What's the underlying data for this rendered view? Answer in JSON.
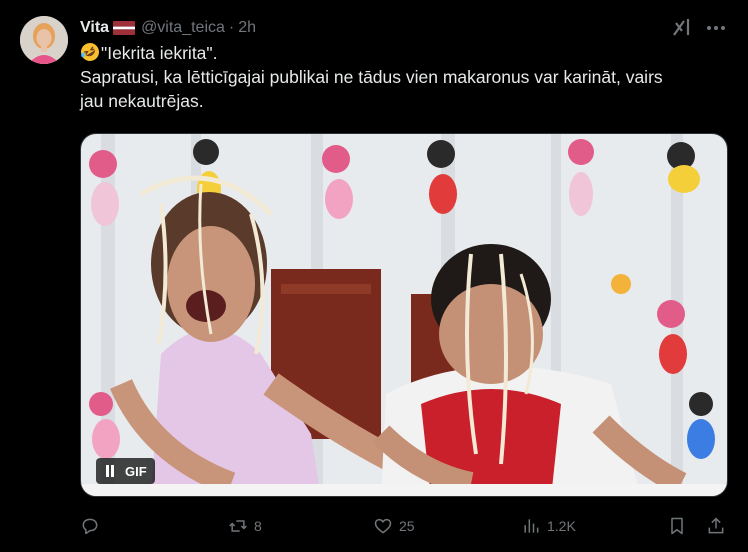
{
  "author": {
    "name": "Vita",
    "handle": "@vita_teica",
    "separator": "·",
    "time": "2h",
    "flag_colors": [
      "#9e3039",
      "#ffffff",
      "#9e3039"
    ]
  },
  "tweet": {
    "line1": "\"Iekrita iekrita\".",
    "line2": "Sapratusi, ka lētticīgajai publikai ne tādus vien makaronus var karināt, vairs",
    "line3": "jau nekautrējas.",
    "emoji": "rolling-on-floor-laughing-emoji"
  },
  "media": {
    "type": "gif",
    "badge_label": "GIF",
    "icon": "pause-icon"
  },
  "actions": {
    "reply": {
      "icon": "reply-icon",
      "count": ""
    },
    "repost": {
      "icon": "repost-icon",
      "count": "8"
    },
    "like": {
      "icon": "heart-icon",
      "count": "25"
    },
    "views": {
      "icon": "views-icon",
      "count": "1.2K"
    },
    "bookmark": {
      "icon": "bookmark-icon"
    },
    "share": {
      "icon": "share-icon"
    }
  },
  "colors": {
    "background": "#000000",
    "text": "#e7e9ea",
    "muted": "#71767b"
  }
}
